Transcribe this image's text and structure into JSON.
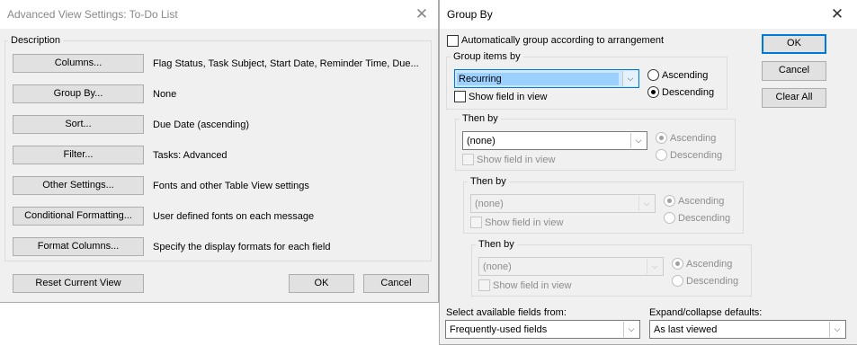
{
  "advanced_dialog": {
    "title": "Advanced View Settings: To-Do List",
    "close_glyph": "✕",
    "description_legend": "Description",
    "rows": [
      {
        "button": "Columns...",
        "desc": "Flag Status, Task Subject, Start Date, Reminder Time, Due..."
      },
      {
        "button": "Group By...",
        "desc": "None"
      },
      {
        "button": "Sort...",
        "desc": "Due Date (ascending)"
      },
      {
        "button": "Filter...",
        "desc": "Tasks: Advanced"
      },
      {
        "button": "Other Settings...",
        "desc": "Fonts and other Table View settings"
      },
      {
        "button": "Conditional Formatting...",
        "desc": "User defined fonts on each message"
      },
      {
        "button": "Format Columns...",
        "desc": "Specify the display formats for each field"
      }
    ],
    "reset_label": "Reset Current View",
    "ok_label": "OK",
    "cancel_label": "Cancel"
  },
  "group_dialog": {
    "title": "Group By",
    "close_glyph": "✕",
    "auto_group_label": "Automatically group according to arrangement",
    "group_items_by": {
      "legend": "Group items by",
      "value": "Recurring",
      "show_field": "Show field in view",
      "ascending": "Ascending",
      "descending": "Descending",
      "selected_order": "descending"
    },
    "then_by": [
      {
        "legend": "Then by",
        "value": "(none)",
        "show_field": "Show field in view",
        "ascending": "Ascending",
        "descending": "Descending",
        "selected_order": "ascending"
      },
      {
        "legend": "Then by",
        "value": "(none)",
        "show_field": "Show field in view",
        "ascending": "Ascending",
        "descending": "Descending",
        "selected_order": "ascending"
      },
      {
        "legend": "Then by",
        "value": "(none)",
        "show_field": "Show field in view",
        "ascending": "Ascending",
        "descending": "Descending",
        "selected_order": "ascending"
      }
    ],
    "ok_label": "OK",
    "cancel_label": "Cancel",
    "clear_all_label": "Clear All",
    "select_fields_label": "Select available fields from:",
    "select_fields_value": "Frequently-used fields",
    "expand_label": "Expand/collapse defaults:",
    "expand_value": "As last viewed",
    "dropdown_glyph": "⌵"
  }
}
